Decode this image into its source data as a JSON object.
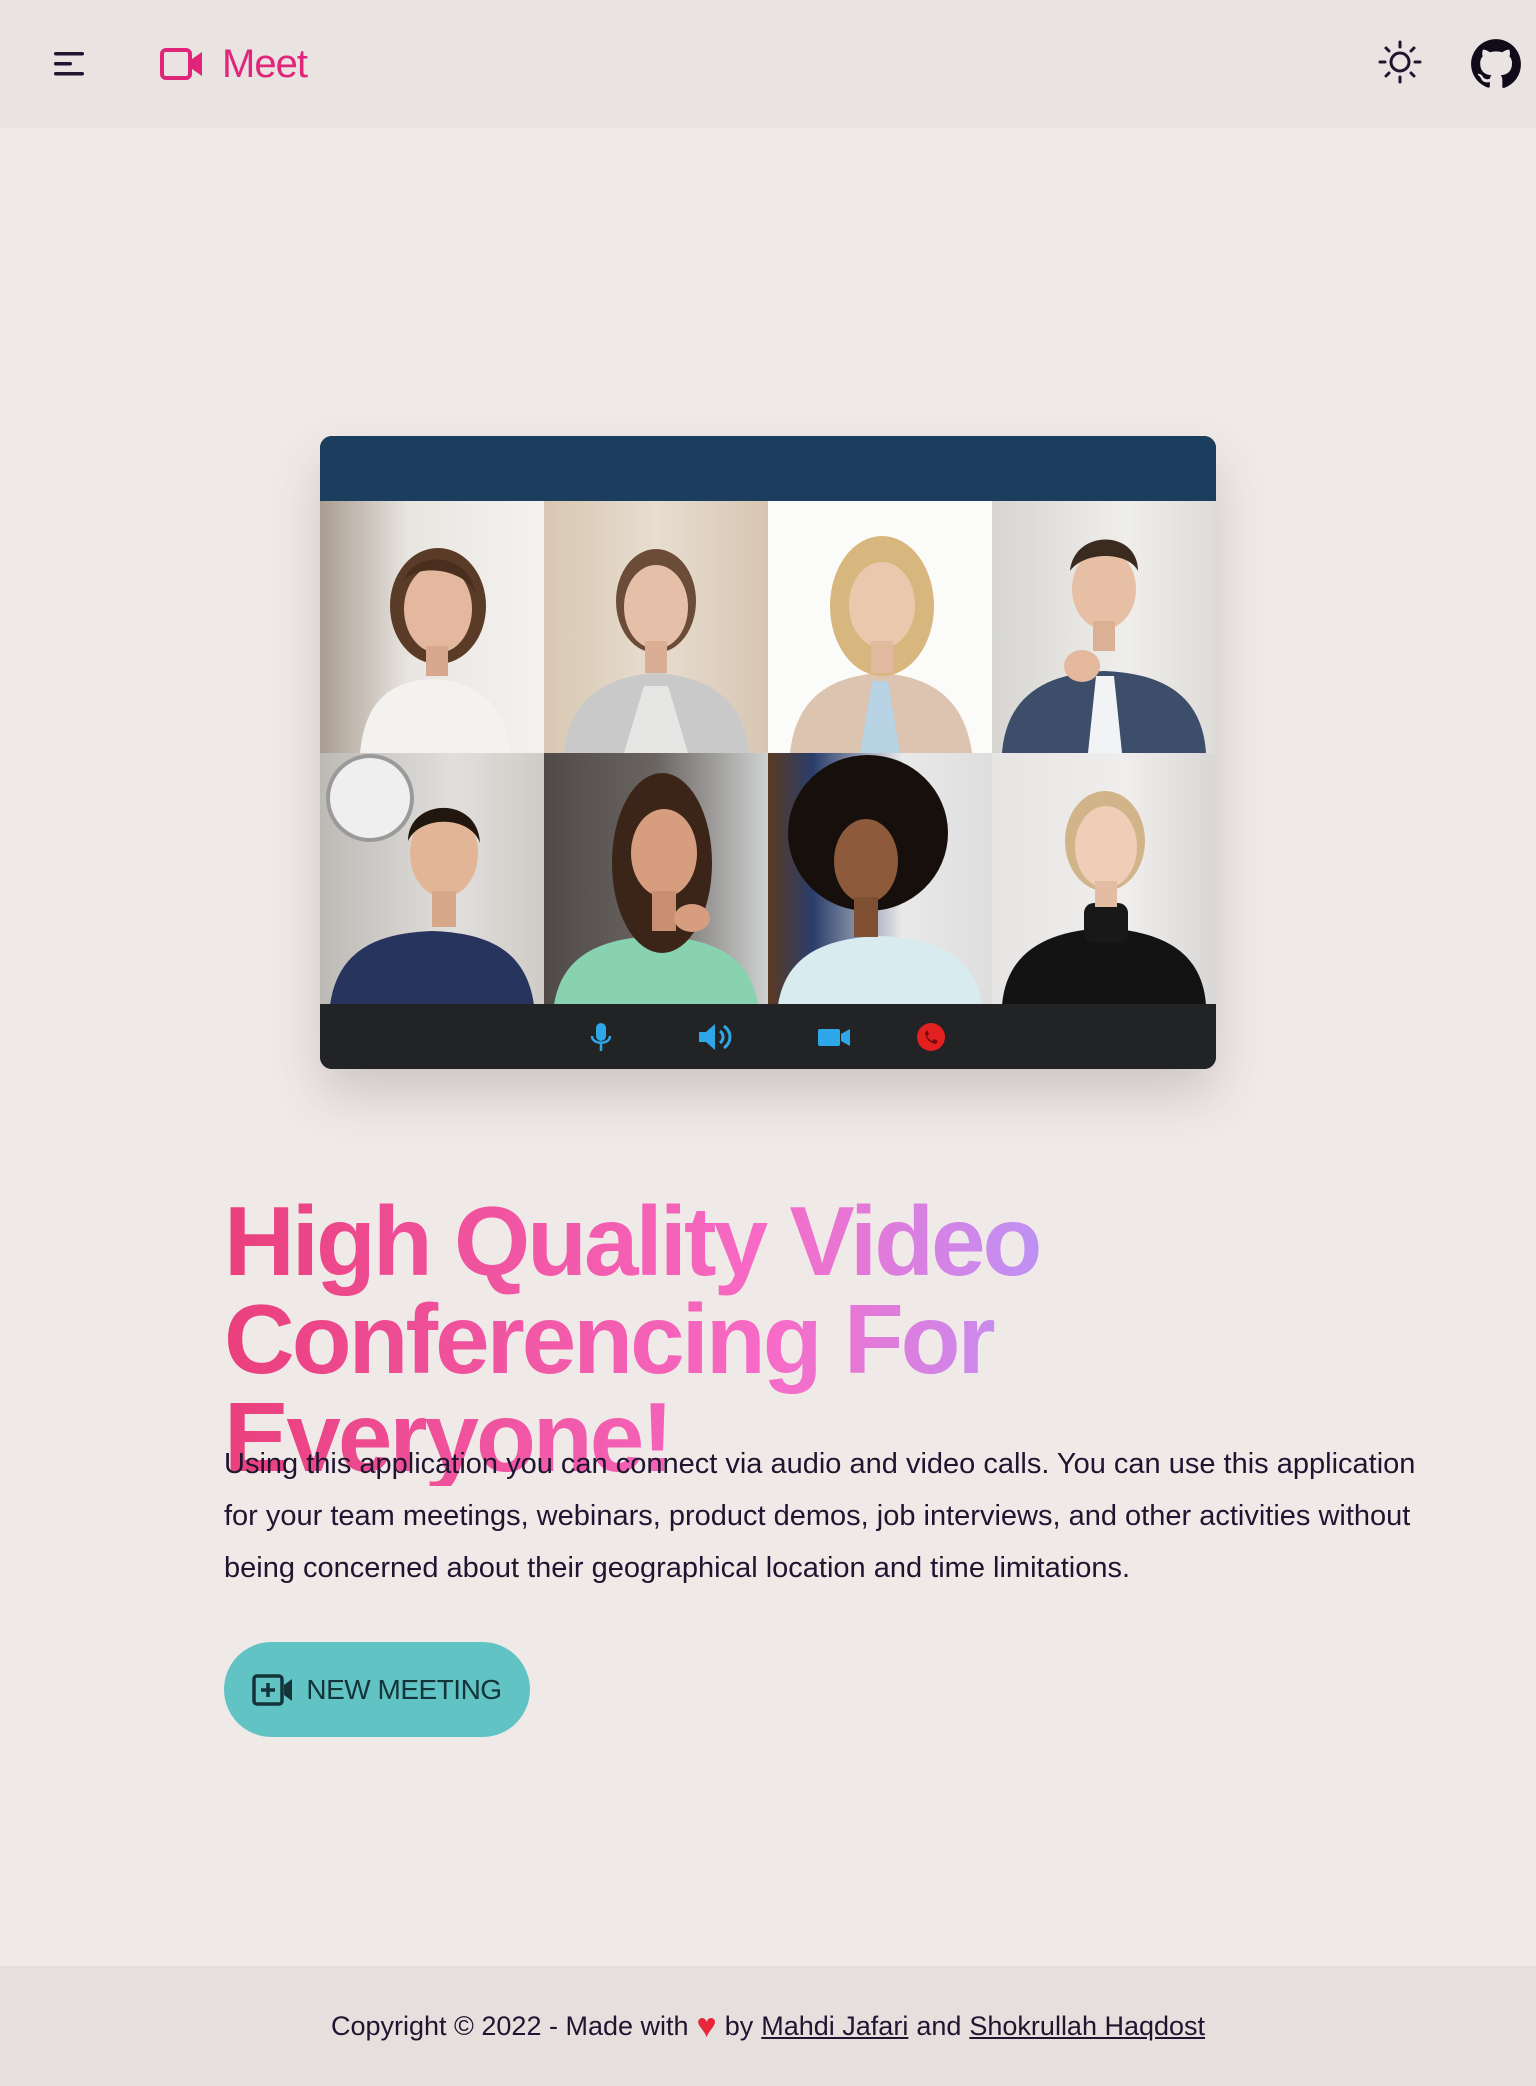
{
  "header": {
    "brand_name": "Meet",
    "icons": {
      "menu": "menu-icon",
      "brand": "video-camera-icon",
      "theme": "sun-icon",
      "github": "github-icon"
    },
    "brand_color": "#e0257a"
  },
  "hero": {
    "illustration": {
      "controls": [
        "microphone-icon",
        "speaker-icon",
        "video-camera-icon",
        "phone-hangup-icon"
      ]
    },
    "title_line1": "High Quality Video",
    "title_line2": "Conferencing For Everyone!",
    "description": "Using this application you can connect via audio and video calls. You can use this application for your team meetings, webinars, product demos, job interviews, and other activities without being concerned about their geographical location and time limitations.",
    "cta_label": "NEW MEETING",
    "cta_color": "#62c3c5"
  },
  "footer": {
    "prefix": "Copyright © 2022 - Made with",
    "by": "by",
    "author1": "Mahdi Jafari",
    "and": "and",
    "author2": "Shokrullah Haqdost"
  }
}
